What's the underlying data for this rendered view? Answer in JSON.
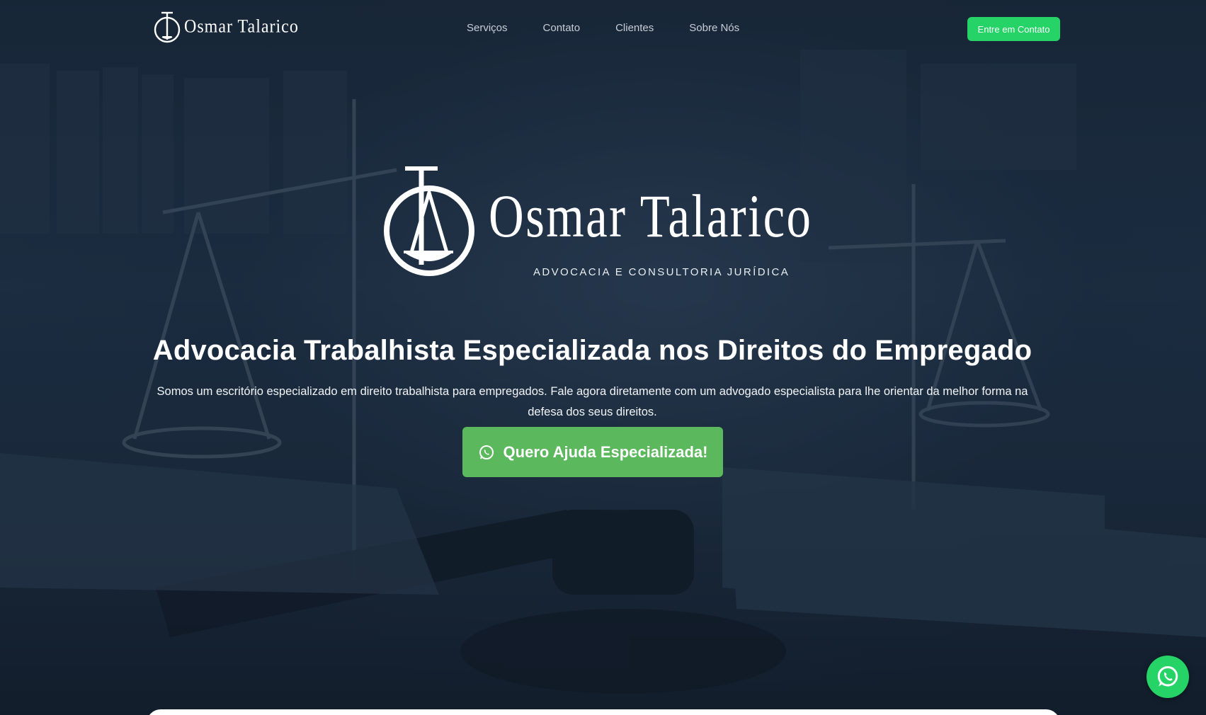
{
  "brand": {
    "name": "Osmar Talarico",
    "tagline": "ADVOCACIA E CONSULTORIA JURÍDICA",
    "small_name": "Osmar Talarico"
  },
  "nav": {
    "items": [
      {
        "label": "Serviços"
      },
      {
        "label": "Contato"
      },
      {
        "label": "Clientes"
      },
      {
        "label": "Sobre Nós"
      }
    ]
  },
  "header_cta": {
    "label": "Entre em Contato"
  },
  "hero": {
    "headline": "Advocacia Trabalhista Especializada nos Direitos do Empregado",
    "subtext": "Somos um escritório especializado em direito trabalhista para empregados. Fale agora diretamente com um advogado especialista para lhe orientar da melhor forma na defesa dos seus direitos.",
    "cta_label": "Quero Ajuda Especializada!",
    "cta_icon": "whatsapp-icon"
  },
  "floating_button": {
    "icon": "whatsapp-icon"
  },
  "colors": {
    "accent_green": "#25d366",
    "cta_green": "#5cb85c",
    "background_navy": "#1a2838"
  }
}
